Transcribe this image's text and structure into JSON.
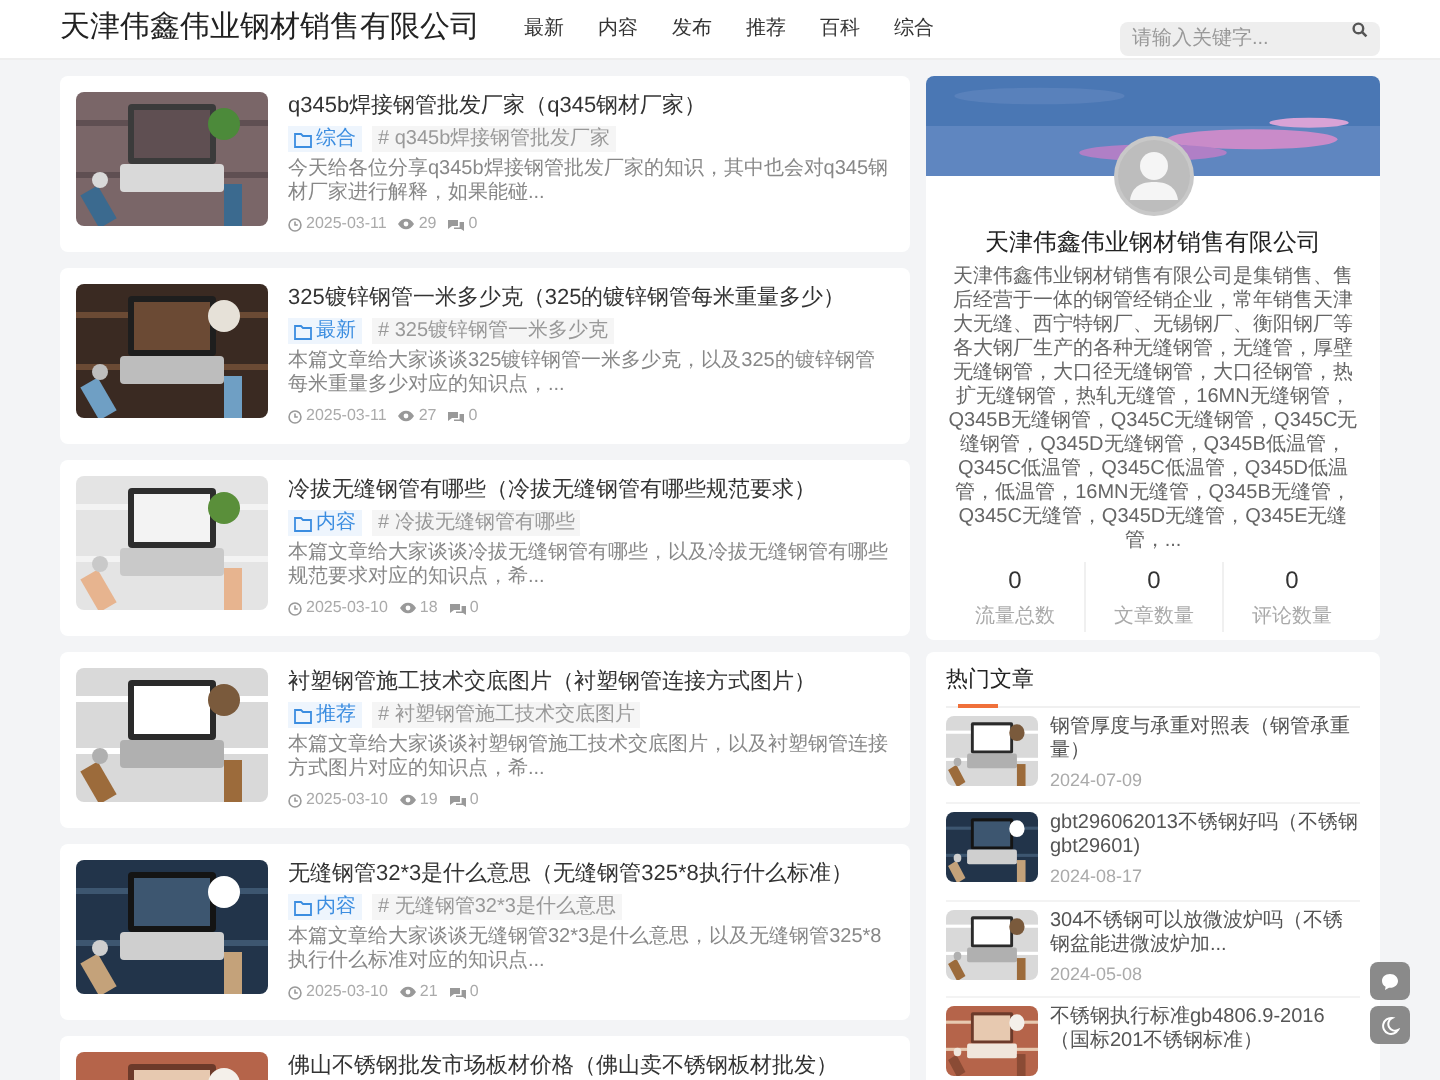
{
  "header": {
    "logo": "天津伟鑫伟业钢材销售有限公司",
    "nav": [
      "最新",
      "内容",
      "发布",
      "推荐",
      "百科",
      "综合"
    ],
    "search": {
      "placeholder": "请输入关键字..."
    }
  },
  "articles": [
    {
      "title": "q345b焊接钢管批发厂家（q345钢材厂家）",
      "category": "综合",
      "tag": "# q345b焊接钢管批发厂家",
      "excerpt": "今天给各位分享q345b焊接钢管批发厂家的知识，其中也会对q345钢材厂家进行解释，如果能碰...",
      "date": "2025-03-11",
      "views": "29",
      "comments": "0"
    },
    {
      "title": "325镀锌钢管一米多少克（325的镀锌钢管每米重量多少）",
      "category": "最新",
      "tag": "# 325镀锌钢管一米多少克",
      "excerpt": "本篇文章给大家谈谈325镀锌钢管一米多少克，以及325的镀锌钢管每米重量多少对应的知识点，...",
      "date": "2025-03-11",
      "views": "27",
      "comments": "0"
    },
    {
      "title": "冷拔无缝钢管有哪些（冷拔无缝钢管有哪些规范要求）",
      "category": "内容",
      "tag": "# 冷拔无缝钢管有哪些",
      "excerpt": "本篇文章给大家谈谈冷拔无缝钢管有哪些，以及冷拔无缝钢管有哪些规范要求对应的知识点，希...",
      "date": "2025-03-10",
      "views": "18",
      "comments": "0"
    },
    {
      "title": "衬塑钢管施工技术交底图片（衬塑钢管连接方式图片）",
      "category": "推荐",
      "tag": "# 衬塑钢管施工技术交底图片",
      "excerpt": "本篇文章给大家谈谈衬塑钢管施工技术交底图片，以及衬塑钢管连接方式图片对应的知识点，希...",
      "date": "2025-03-10",
      "views": "19",
      "comments": "0"
    },
    {
      "title": "无缝钢管32*3是什么意思（无缝钢管325*8执行什么标准）",
      "category": "内容",
      "tag": "# 无缝钢管32*3是什么意思",
      "excerpt": "本篇文章给大家谈谈无缝钢管32*3是什么意思，以及无缝钢管325*8执行什么标准对应的知识点...",
      "date": "2025-03-10",
      "views": "21",
      "comments": "0"
    },
    {
      "title": "佛山不锈钢批发市场板材价格（佛山卖不锈钢板材批发）"
    }
  ],
  "profile": {
    "name": "天津伟鑫伟业钢材销售有限公司",
    "description": "天津伟鑫伟业钢材销售有限公司是集销售、售后经营于一体的钢管经销企业，常年销售天津大无缝、西宁特钢厂、无锡钢厂、衡阳钢厂等各大钢厂生产的各种无缝钢管，无缝管，厚壁无缝钢管，大口径无缝钢管，大口径钢管，热扩无缝钢管，热轧无缝管，16MN无缝钢管，Q345B无缝钢管，Q345C无缝钢管，Q345C无缝钢管，Q345D无缝钢管，Q345B低温管，Q345C低温管，Q345C低温管，Q345D低温管，低温管，16MN无缝管，Q345B无缝管，Q345C无缝管，Q345D无缝管，Q345E无缝管，...",
    "stats": [
      {
        "value": "0",
        "label": "流量总数"
      },
      {
        "value": "0",
        "label": "文章数量"
      },
      {
        "value": "0",
        "label": "评论数量"
      }
    ]
  },
  "hot": {
    "title": "热门文章",
    "items": [
      {
        "title": "钢管厚度与承重对照表（钢管承重量）",
        "date": "2024-07-09"
      },
      {
        "title": "gbt296062013不锈钢好吗（不锈钢gbt29601)",
        "date": "2024-08-17"
      },
      {
        "title": "304不锈钢可以放微波炉吗（不锈钢盆能进微波炉加...",
        "date": "2024-05-08"
      },
      {
        "title": "不锈钢执行标准gb4806.9-2016（国标201不锈钢标准）"
      }
    ]
  }
}
